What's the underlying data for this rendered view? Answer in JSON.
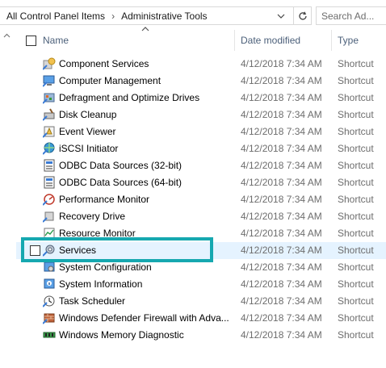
{
  "address": {
    "crumbs": [
      "All Control Panel Items",
      "Administrative Tools"
    ],
    "search_placeholder": "Search Ad..."
  },
  "columns": {
    "name": "Name",
    "date": "Date modified",
    "type": "Type"
  },
  "rows": [
    {
      "name": "Component Services",
      "date": "4/12/2018 7:34 AM",
      "type": "Shortcut",
      "icon": "component-services-icon"
    },
    {
      "name": "Computer Management",
      "date": "4/12/2018 7:34 AM",
      "type": "Shortcut",
      "icon": "computer-management-icon"
    },
    {
      "name": "Defragment and Optimize Drives",
      "date": "4/12/2018 7:34 AM",
      "type": "Shortcut",
      "icon": "defragment-icon"
    },
    {
      "name": "Disk Cleanup",
      "date": "4/12/2018 7:34 AM",
      "type": "Shortcut",
      "icon": "disk-cleanup-icon"
    },
    {
      "name": "Event Viewer",
      "date": "4/12/2018 7:34 AM",
      "type": "Shortcut",
      "icon": "event-viewer-icon"
    },
    {
      "name": "iSCSI Initiator",
      "date": "4/12/2018 7:34 AM",
      "type": "Shortcut",
      "icon": "iscsi-icon"
    },
    {
      "name": "ODBC Data Sources (32-bit)",
      "date": "4/12/2018 7:34 AM",
      "type": "Shortcut",
      "icon": "odbc-icon"
    },
    {
      "name": "ODBC Data Sources (64-bit)",
      "date": "4/12/2018 7:34 AM",
      "type": "Shortcut",
      "icon": "odbc-icon"
    },
    {
      "name": "Performance Monitor",
      "date": "4/12/2018 7:34 AM",
      "type": "Shortcut",
      "icon": "performance-monitor-icon"
    },
    {
      "name": "Recovery Drive",
      "date": "4/12/2018 7:34 AM",
      "type": "Shortcut",
      "icon": "recovery-drive-icon"
    },
    {
      "name": "Resource Monitor",
      "date": "4/12/2018 7:34 AM",
      "type": "Shortcut",
      "icon": "resource-monitor-icon"
    },
    {
      "name": "Services",
      "date": "4/12/2018 7:34 AM",
      "type": "Shortcut",
      "icon": "services-icon"
    },
    {
      "name": "System Configuration",
      "date": "4/12/2018 7:34 AM",
      "type": "Shortcut",
      "icon": "system-configuration-icon"
    },
    {
      "name": "System Information",
      "date": "4/12/2018 7:34 AM",
      "type": "Shortcut",
      "icon": "system-information-icon"
    },
    {
      "name": "Task Scheduler",
      "date": "4/12/2018 7:34 AM",
      "type": "Shortcut",
      "icon": "task-scheduler-icon"
    },
    {
      "name": "Windows Defender Firewall with Adva...",
      "date": "4/12/2018 7:34 AM",
      "type": "Shortcut",
      "icon": "firewall-icon"
    },
    {
      "name": "Windows Memory Diagnostic",
      "date": "4/12/2018 7:34 AM",
      "type": "Shortcut",
      "icon": "memory-diagnostic-icon"
    }
  ],
  "hovered_row": "Services",
  "colors": {
    "highlight": "#16a8b0",
    "hover": "#e5f3ff",
    "header_text": "#4c607a"
  }
}
